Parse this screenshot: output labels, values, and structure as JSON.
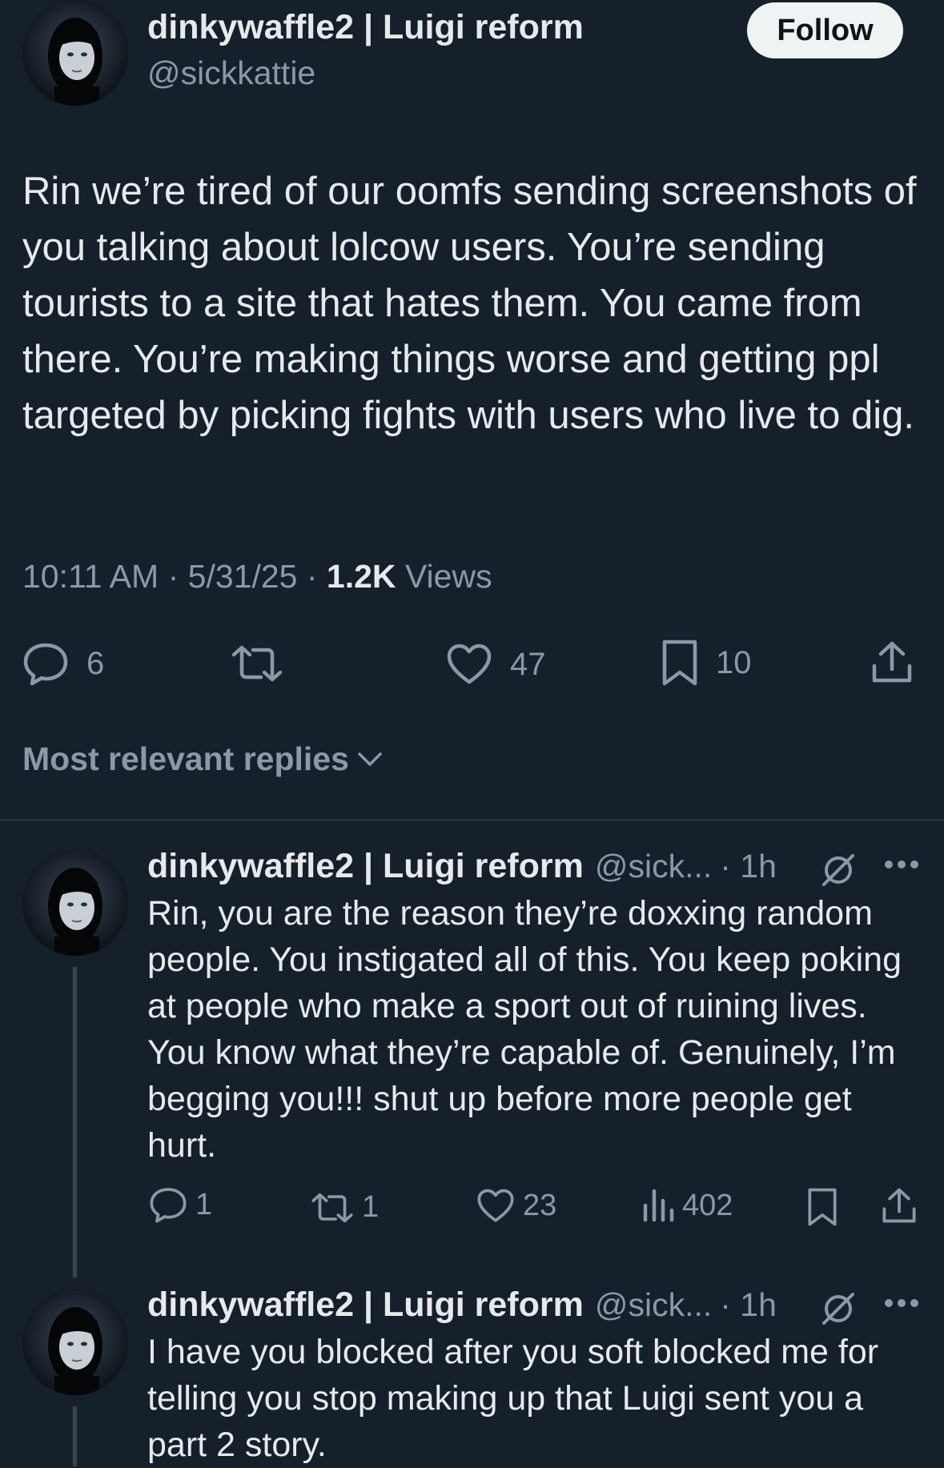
{
  "tweet": {
    "author": {
      "display_name": "dinkywaffle2 | Luigi reform",
      "handle": "@sickkattie"
    },
    "follow_label": "Follow",
    "text": "Rin we’re tired of our oomfs sending screenshots of you talking about lolcow users. You’re sending tourists to a site that hates them. You came from there. You’re making things worse and getting ppl targeted by picking fights with users who live to dig.",
    "time": "10:11 AM",
    "date": "5/31/25",
    "views_count": "1.2K",
    "views_label": "Views",
    "separator": "·",
    "stats": {
      "replies": "6",
      "likes": "47",
      "bookmarks": "10"
    }
  },
  "replies_sort_label": "Most relevant replies",
  "replies": [
    {
      "display_name": "dinkywaffle2 | Luigi reform",
      "handle": "@sick...",
      "time": "· 1h",
      "text": "Rin, you are the reason they’re doxxing random people. You instigated all of this. You keep poking at people who make a sport out of ruining lives. You know what they’re capable of. Genuinely, I’m begging you!!! shut up before more people get hurt.",
      "stats": {
        "replies": "1",
        "reposts": "1",
        "likes": "23",
        "views": "402"
      }
    },
    {
      "display_name": "dinkywaffle2 | Luigi reform",
      "handle": "@sick...",
      "time": "· 1h",
      "text": "I have you blocked after you soft blocked me for telling you stop making up that Luigi sent you a part 2 story."
    }
  ],
  "colors": {
    "background": "#15202b",
    "text_primary": "#e7e9ea",
    "text_secondary": "#8b98a5",
    "divider": "#38444d",
    "follow_bg": "#eff3f4"
  },
  "icons": {
    "reply": "speech-bubble-icon",
    "repost": "repost-arrows-icon",
    "like": "heart-outline-icon",
    "bookmark": "bookmark-icon",
    "share": "share-upload-icon",
    "views": "bar-chart-icon",
    "grok": "grok-slash-icon",
    "more": "more-dots-icon",
    "chevron": "chevron-down-icon"
  }
}
